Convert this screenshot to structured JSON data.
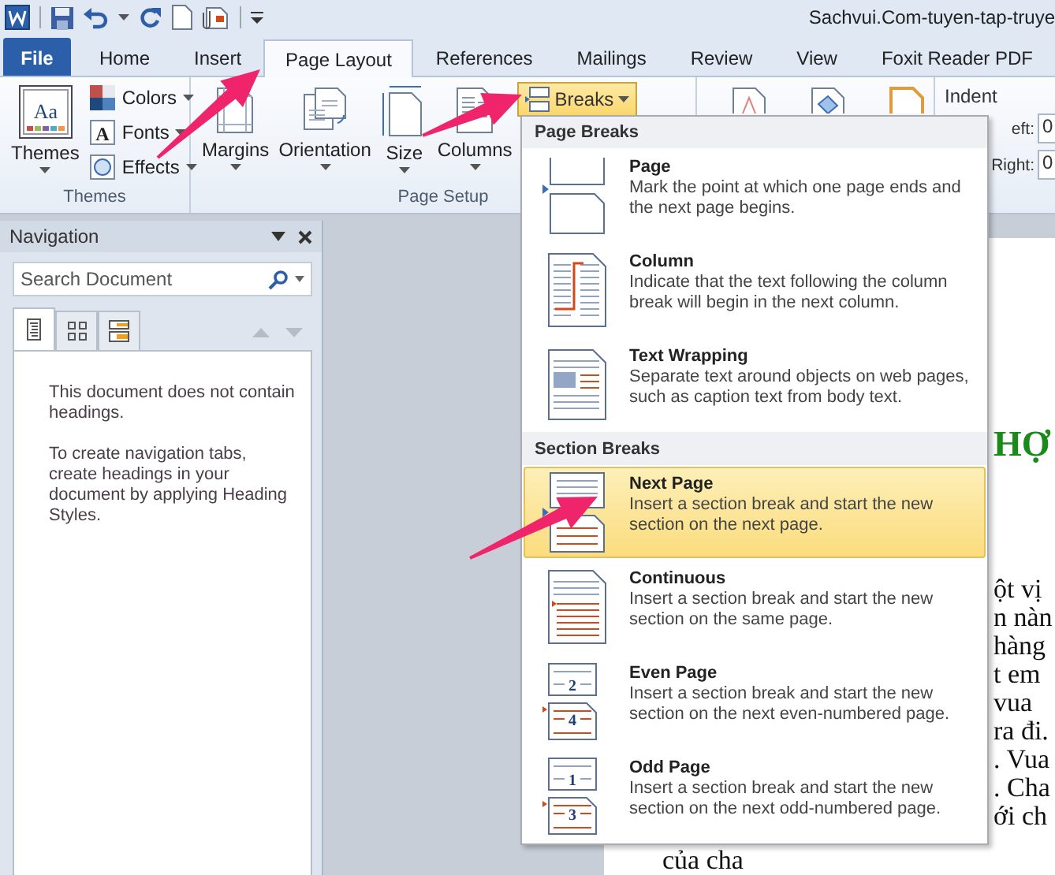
{
  "title_bar": {
    "title": "Sachvui.Com-tuyen-tap-truye"
  },
  "ribbon_tabs": [
    {
      "label": "File",
      "kind": "file",
      "selected": false
    },
    {
      "label": "Home",
      "kind": "tab",
      "selected": false
    },
    {
      "label": "Insert",
      "kind": "tab",
      "selected": false
    },
    {
      "label": "Page Layout",
      "kind": "tab",
      "selected": true
    },
    {
      "label": "References",
      "kind": "tab",
      "selected": false
    },
    {
      "label": "Mailings",
      "kind": "tab",
      "selected": false
    },
    {
      "label": "Review",
      "kind": "tab",
      "selected": false
    },
    {
      "label": "View",
      "kind": "tab",
      "selected": false
    },
    {
      "label": "Foxit Reader PDF",
      "kind": "tab",
      "selected": false
    }
  ],
  "ribbon": {
    "themes_group": {
      "label": "Themes",
      "big_button": {
        "label": "Themes",
        "icon_text": "Aa"
      },
      "small_buttons": [
        {
          "kind": "colors",
          "label": "Colors"
        },
        {
          "kind": "fonts",
          "label": "Fonts",
          "icon_text": "A"
        },
        {
          "kind": "effects",
          "label": "Effects"
        }
      ]
    },
    "page_setup_group": {
      "label": "Page Setup",
      "buttons": [
        {
          "kind": "margins",
          "label": "Margins"
        },
        {
          "kind": "orientation",
          "label": "Orientation"
        },
        {
          "kind": "size",
          "label": "Size"
        },
        {
          "kind": "columns",
          "label": "Columns"
        }
      ],
      "breaks": {
        "label": "Breaks",
        "expanded": true
      }
    },
    "paragraph_group": {
      "indent_label": "Indent",
      "fields": [
        {
          "label": "eft:",
          "value": "0"
        },
        {
          "label": "Right:",
          "value": "0"
        }
      ]
    }
  },
  "navigation": {
    "title": "Navigation",
    "search": {
      "placeholder": "Search Document"
    },
    "tabs": [
      {
        "kind": "headings",
        "selected": true
      },
      {
        "kind": "pages",
        "selected": false
      },
      {
        "kind": "results",
        "selected": false
      }
    ],
    "browse_disabled": true,
    "messages": [
      "This document does not contain headings.",
      "To create navigation tabs, create headings in your document by applying Heading Styles."
    ]
  },
  "breaks_menu": {
    "sections": [
      {
        "heading": "Page Breaks",
        "items": [
          {
            "kind": "page",
            "title": "Page",
            "description": "Mark the point at which one page ends and the next page begins.",
            "selected": false
          },
          {
            "kind": "column",
            "title": "Column",
            "description": "Indicate that the text following the column break will begin in the next column.",
            "selected": false
          },
          {
            "kind": "text-wrapping",
            "title": "Text Wrapping",
            "description": "Separate text around objects on web pages, such as caption text from body text.",
            "selected": false
          }
        ]
      },
      {
        "heading": "Section Breaks",
        "items": [
          {
            "kind": "next-page",
            "title": "Next Page",
            "description": "Insert a section break and start the new section on the next page.",
            "selected": true
          },
          {
            "kind": "continuous",
            "title": "Continuous",
            "description": "Insert a section break and start the new section on the same page.",
            "selected": false
          },
          {
            "kind": "even-page",
            "title": "Even Page",
            "description": "Insert a section break and start the new section on the next even-numbered page.",
            "selected": false,
            "page_numbers": [
              "2",
              "4"
            ]
          },
          {
            "kind": "odd-page",
            "title": "Odd Page",
            "description": "Insert a section break and start the new section on the next odd-numbered page.",
            "selected": false,
            "page_numbers": [
              "1",
              "3"
            ]
          }
        ]
      }
    ]
  },
  "document": {
    "heading": "HỢ",
    "line_ends": [
      "ột vị",
      "n nàn",
      "hàng",
      "t em",
      "vua",
      "ra đi.",
      ". Vua",
      ". Cha",
      "ới ch"
    ],
    "last_line": "của cha"
  }
}
